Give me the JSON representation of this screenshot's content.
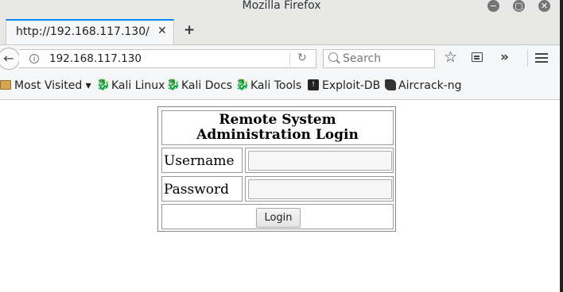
{
  "window": {
    "title": "Mozilla Firefox",
    "minimize_glyph": "−",
    "maximize_glyph": "▢",
    "close_glyph": "✕"
  },
  "tabs": [
    {
      "title": "http://192.168.117.130/",
      "close_glyph": "✕",
      "active": true
    }
  ],
  "new_tab_glyph": "+",
  "nav": {
    "back_glyph": "←",
    "url": "192.168.117.130",
    "reload_glyph": "↻",
    "search_placeholder": "Search",
    "overflow_glyph": "»",
    "star_glyph": "☆"
  },
  "bookmarks": [
    {
      "label": "Most Visited ▾",
      "icon": "folder-icon"
    },
    {
      "label": "Kali Linux",
      "icon": "kali-dragon-icon"
    },
    {
      "label": "Kali Docs",
      "icon": "kali-dragon-icon"
    },
    {
      "label": "Kali Tools",
      "icon": "kali-dragon-icon"
    },
    {
      "label": "Exploit-DB",
      "icon": "exploit-db-icon"
    },
    {
      "label": "Aircrack-ng",
      "icon": "aircrack-icon"
    }
  ],
  "page": {
    "heading": "Remote System Administration Login",
    "username_label": "Username",
    "password_label": "Password",
    "username_value": "",
    "password_value": "",
    "login_button": "Login"
  }
}
